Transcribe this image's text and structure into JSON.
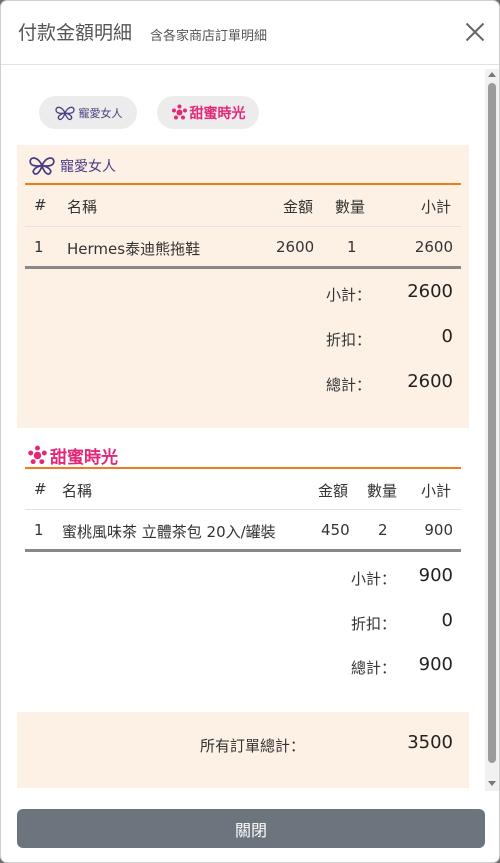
{
  "header": {
    "title": "付款金額明細",
    "subtitle": "含各家商店訂單明細"
  },
  "chips": [
    {
      "text": "寵愛女人"
    },
    {
      "text": "甜蜜時光"
    }
  ],
  "stores": [
    {
      "name": "寵愛女人",
      "columns": {
        "no": "#",
        "name": "名稱",
        "amount": "金額",
        "qty": "數量",
        "subtotal": "小計"
      },
      "rows": [
        {
          "no": "1",
          "name": "Hermes泰迪熊拖鞋",
          "amount": "2600",
          "qty": "1",
          "subtotal": "2600"
        }
      ],
      "summary": {
        "subtotal_label": "小計：",
        "subtotal": "2600",
        "discount_label": "折扣：",
        "discount": "0",
        "total_label": "總計：",
        "total": "2600"
      }
    },
    {
      "name": "甜蜜時光",
      "columns": {
        "no": "#",
        "name": "名稱",
        "amount": "金額",
        "qty": "數量",
        "subtotal": "小計"
      },
      "rows": [
        {
          "no": "1",
          "name": "蜜桃風味茶 立體茶包 20入/罐裝",
          "amount": "450",
          "qty": "2",
          "subtotal": "900"
        }
      ],
      "summary": {
        "subtotal_label": "小計：",
        "subtotal": "900",
        "discount_label": "折扣：",
        "discount": "0",
        "total_label": "總計：",
        "total": "900"
      }
    }
  ],
  "grand_total": {
    "label": "所有訂單總計：",
    "value": "3500"
  },
  "footer": {
    "close_label": "關閉"
  },
  "colors": {
    "accent": "#f07c1c",
    "panel": "#fdf1e6",
    "button": "#6c757d",
    "brand_pink": "#e3287a",
    "brand_purple": "#4a3d82"
  }
}
